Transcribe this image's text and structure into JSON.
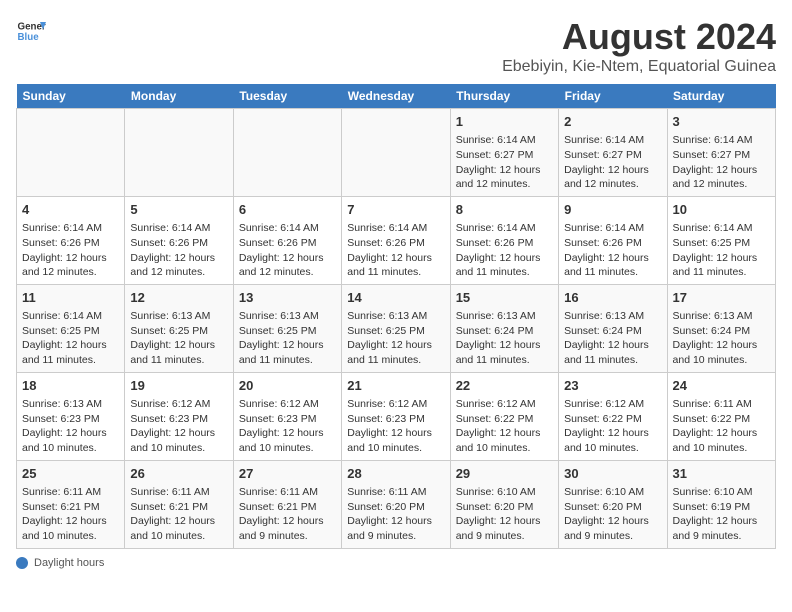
{
  "header": {
    "logo_line1": "General",
    "logo_line2": "Blue",
    "title": "August 2024",
    "subtitle": "Ebebiyin, Kie-Ntem, Equatorial Guinea"
  },
  "days_of_week": [
    "Sunday",
    "Monday",
    "Tuesday",
    "Wednesday",
    "Thursday",
    "Friday",
    "Saturday"
  ],
  "footer_label": "Daylight hours",
  "weeks": [
    [
      {
        "day": "",
        "content": ""
      },
      {
        "day": "",
        "content": ""
      },
      {
        "day": "",
        "content": ""
      },
      {
        "day": "",
        "content": ""
      },
      {
        "day": "1",
        "content": "Sunrise: 6:14 AM\nSunset: 6:27 PM\nDaylight: 12 hours and 12 minutes."
      },
      {
        "day": "2",
        "content": "Sunrise: 6:14 AM\nSunset: 6:27 PM\nDaylight: 12 hours and 12 minutes."
      },
      {
        "day": "3",
        "content": "Sunrise: 6:14 AM\nSunset: 6:27 PM\nDaylight: 12 hours and 12 minutes."
      }
    ],
    [
      {
        "day": "4",
        "content": "Sunrise: 6:14 AM\nSunset: 6:26 PM\nDaylight: 12 hours and 12 minutes."
      },
      {
        "day": "5",
        "content": "Sunrise: 6:14 AM\nSunset: 6:26 PM\nDaylight: 12 hours and 12 minutes."
      },
      {
        "day": "6",
        "content": "Sunrise: 6:14 AM\nSunset: 6:26 PM\nDaylight: 12 hours and 12 minutes."
      },
      {
        "day": "7",
        "content": "Sunrise: 6:14 AM\nSunset: 6:26 PM\nDaylight: 12 hours and 11 minutes."
      },
      {
        "day": "8",
        "content": "Sunrise: 6:14 AM\nSunset: 6:26 PM\nDaylight: 12 hours and 11 minutes."
      },
      {
        "day": "9",
        "content": "Sunrise: 6:14 AM\nSunset: 6:26 PM\nDaylight: 12 hours and 11 minutes."
      },
      {
        "day": "10",
        "content": "Sunrise: 6:14 AM\nSunset: 6:25 PM\nDaylight: 12 hours and 11 minutes."
      }
    ],
    [
      {
        "day": "11",
        "content": "Sunrise: 6:14 AM\nSunset: 6:25 PM\nDaylight: 12 hours and 11 minutes."
      },
      {
        "day": "12",
        "content": "Sunrise: 6:13 AM\nSunset: 6:25 PM\nDaylight: 12 hours and 11 minutes."
      },
      {
        "day": "13",
        "content": "Sunrise: 6:13 AM\nSunset: 6:25 PM\nDaylight: 12 hours and 11 minutes."
      },
      {
        "day": "14",
        "content": "Sunrise: 6:13 AM\nSunset: 6:25 PM\nDaylight: 12 hours and 11 minutes."
      },
      {
        "day": "15",
        "content": "Sunrise: 6:13 AM\nSunset: 6:24 PM\nDaylight: 12 hours and 11 minutes."
      },
      {
        "day": "16",
        "content": "Sunrise: 6:13 AM\nSunset: 6:24 PM\nDaylight: 12 hours and 11 minutes."
      },
      {
        "day": "17",
        "content": "Sunrise: 6:13 AM\nSunset: 6:24 PM\nDaylight: 12 hours and 10 minutes."
      }
    ],
    [
      {
        "day": "18",
        "content": "Sunrise: 6:13 AM\nSunset: 6:23 PM\nDaylight: 12 hours and 10 minutes."
      },
      {
        "day": "19",
        "content": "Sunrise: 6:12 AM\nSunset: 6:23 PM\nDaylight: 12 hours and 10 minutes."
      },
      {
        "day": "20",
        "content": "Sunrise: 6:12 AM\nSunset: 6:23 PM\nDaylight: 12 hours and 10 minutes."
      },
      {
        "day": "21",
        "content": "Sunrise: 6:12 AM\nSunset: 6:23 PM\nDaylight: 12 hours and 10 minutes."
      },
      {
        "day": "22",
        "content": "Sunrise: 6:12 AM\nSunset: 6:22 PM\nDaylight: 12 hours and 10 minutes."
      },
      {
        "day": "23",
        "content": "Sunrise: 6:12 AM\nSunset: 6:22 PM\nDaylight: 12 hours and 10 minutes."
      },
      {
        "day": "24",
        "content": "Sunrise: 6:11 AM\nSunset: 6:22 PM\nDaylight: 12 hours and 10 minutes."
      }
    ],
    [
      {
        "day": "25",
        "content": "Sunrise: 6:11 AM\nSunset: 6:21 PM\nDaylight: 12 hours and 10 minutes."
      },
      {
        "day": "26",
        "content": "Sunrise: 6:11 AM\nSunset: 6:21 PM\nDaylight: 12 hours and 10 minutes."
      },
      {
        "day": "27",
        "content": "Sunrise: 6:11 AM\nSunset: 6:21 PM\nDaylight: 12 hours and 9 minutes."
      },
      {
        "day": "28",
        "content": "Sunrise: 6:11 AM\nSunset: 6:20 PM\nDaylight: 12 hours and 9 minutes."
      },
      {
        "day": "29",
        "content": "Sunrise: 6:10 AM\nSunset: 6:20 PM\nDaylight: 12 hours and 9 minutes."
      },
      {
        "day": "30",
        "content": "Sunrise: 6:10 AM\nSunset: 6:20 PM\nDaylight: 12 hours and 9 minutes."
      },
      {
        "day": "31",
        "content": "Sunrise: 6:10 AM\nSunset: 6:19 PM\nDaylight: 12 hours and 9 minutes."
      }
    ]
  ]
}
